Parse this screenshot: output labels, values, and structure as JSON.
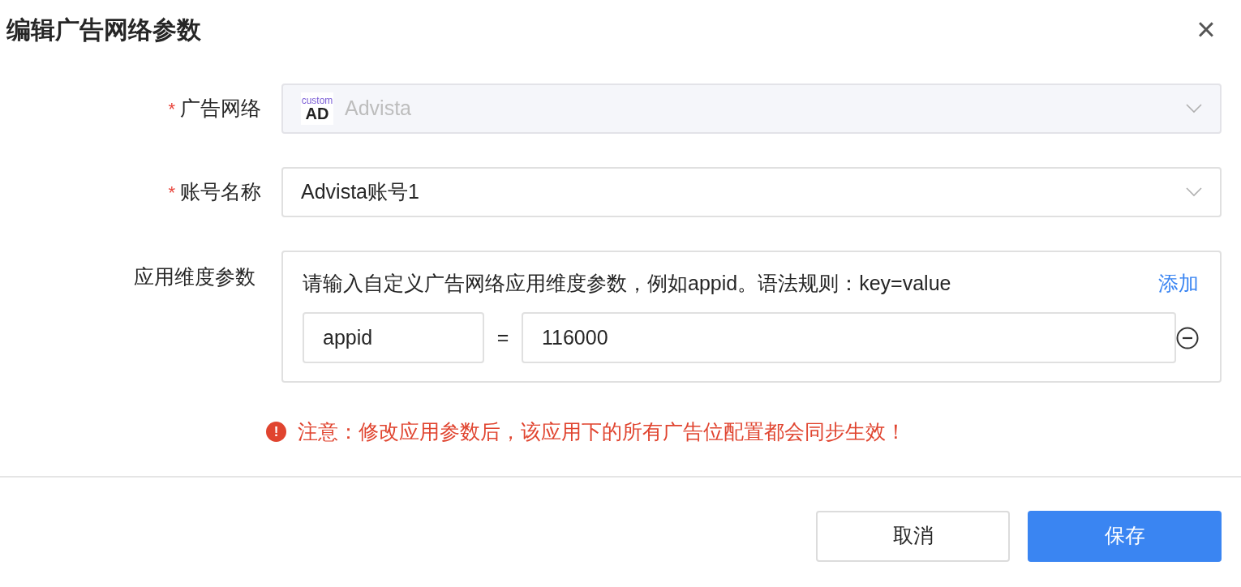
{
  "dialog": {
    "title": "编辑广告网络参数",
    "close_icon": "×"
  },
  "fields": [
    {
      "kind": "select",
      "label": "广告网络",
      "required_mark": "*",
      "disabled": true,
      "logo": {
        "top": "custom",
        "bottom": "AD"
      },
      "value": "Advista"
    },
    {
      "kind": "select",
      "label": "账号名称",
      "required_mark": "*",
      "disabled": false,
      "value": "Advista账号1"
    },
    {
      "kind": "params",
      "label": "应用维度参数",
      "hint": "请输入自定义广告网络应用维度参数，例如appid。语法规则：key=value",
      "add_link": "添加",
      "params": [
        {
          "key": "appid",
          "equals": "=",
          "value": "116000"
        }
      ]
    }
  ],
  "warning": {
    "icon": "!",
    "text": "注意：修改应用参数后，该应用下的所有广告位配置都会同步生效！"
  },
  "buttons": [
    {
      "label": "取消",
      "kind": "secondary"
    },
    {
      "label": "保存",
      "kind": "primary"
    }
  ]
}
